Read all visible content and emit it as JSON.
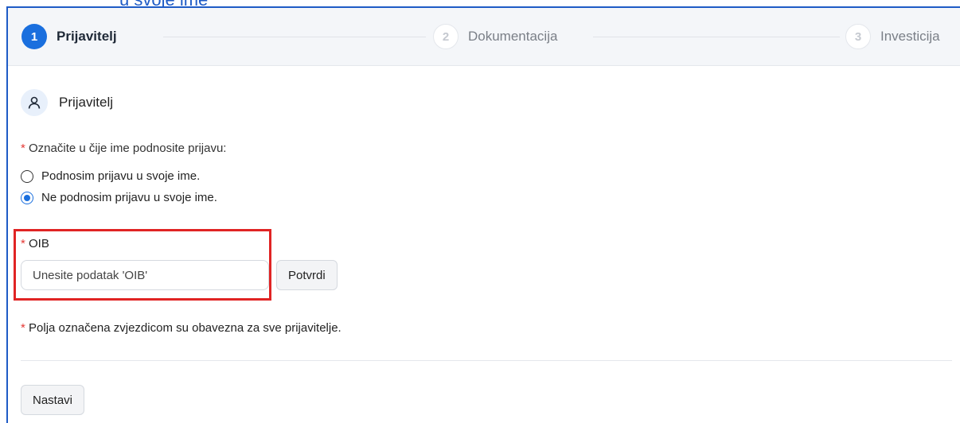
{
  "top_cropped_text": "u svoje ime",
  "stepper": {
    "steps": [
      {
        "number": "1",
        "label": "Prijavitelj",
        "state": "active"
      },
      {
        "number": "2",
        "label": "Dokumentacija",
        "state": "inactive"
      },
      {
        "number": "3",
        "label": "Investicija",
        "state": "inactive"
      }
    ]
  },
  "section": {
    "title": "Prijavitelj",
    "icon": "user-icon"
  },
  "form": {
    "required_mark": "*",
    "question": "Označite u čije ime podnosite prijavu:",
    "options": [
      {
        "label": "Podnosim prijavu u svoje ime.",
        "checked": false
      },
      {
        "label": "Ne podnosim prijavu u svoje ime.",
        "checked": true
      }
    ],
    "oib": {
      "label": "OIB",
      "placeholder": "Unesite podatak 'OIB'",
      "value": "",
      "confirm_label": "Potvrdi"
    },
    "required_note": "Polja označena zvjezdicom su obavezna za sve prijavitelje."
  },
  "actions": {
    "continue_label": "Nastavi"
  },
  "colors": {
    "accent": "#1a6fde",
    "required": "#e53935",
    "highlight": "#e02424"
  }
}
